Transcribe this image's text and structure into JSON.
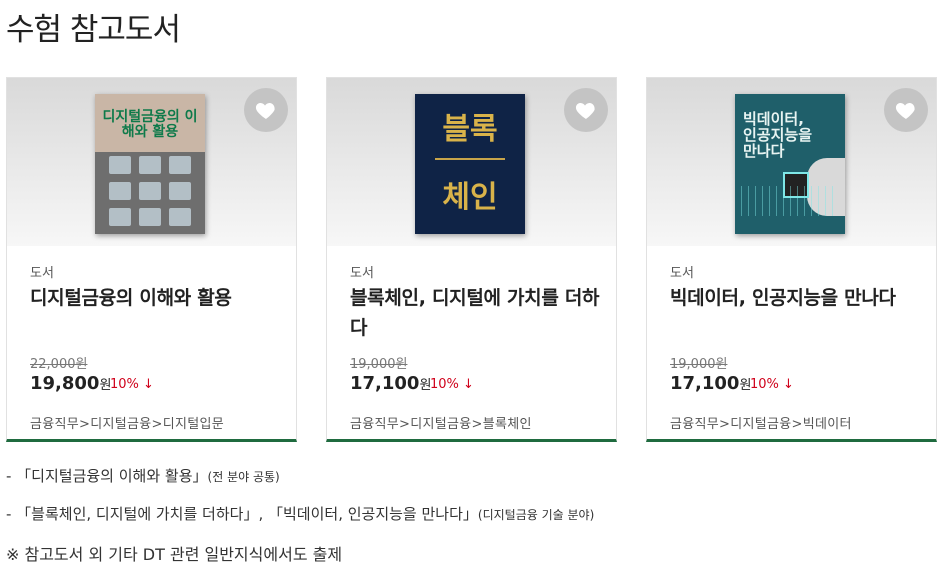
{
  "page_title": "수험 참고도서",
  "books": [
    {
      "category": "도서",
      "title": "디지털금융의 이해와 활용",
      "original_price": "22,000원",
      "price": "19,800",
      "won": "원",
      "discount": "10% ↓",
      "path": "금융직무>디지털금융>디지털입문",
      "cover_title": "디지털금융의 이해와 활용"
    },
    {
      "category": "도서",
      "title": "블록체인, 디지털에 가치를 더하다",
      "original_price": "19,000원",
      "price": "17,100",
      "won": "원",
      "discount": "10% ↓",
      "path": "금융직무>디지털금융>블록체인",
      "cover_title": "블록",
      "cover_title2": "체인"
    },
    {
      "category": "도서",
      "title": "빅데이터, 인공지능을 만나다",
      "original_price": "19,000원",
      "price": "17,100",
      "won": "원",
      "discount": "10% ↓",
      "path": "금융직무>디지털금융>빅데이터",
      "cover_title": "빅데이터, 인공지능을 만나다"
    }
  ],
  "notes": {
    "line1_main": "- 「디지털금융의 이해와 활용」",
    "line1_small": "(전 분야 공통)",
    "line2_main": "- 「블록체인, 디지털에 가치를 더하다」, 「빅데이터, 인공지능을 만나다」",
    "line2_small": "(디지털금융 기술 분야)",
    "line3": "※ 참고도서 외 기타 DT 관련 일반지식에서도 출제"
  },
  "colors": {
    "accent_border": "#1f6b3f",
    "discount": "#d0021b",
    "heart_bg": "#c4c4c4"
  },
  "icons": {
    "wishlist": "heart-icon"
  }
}
